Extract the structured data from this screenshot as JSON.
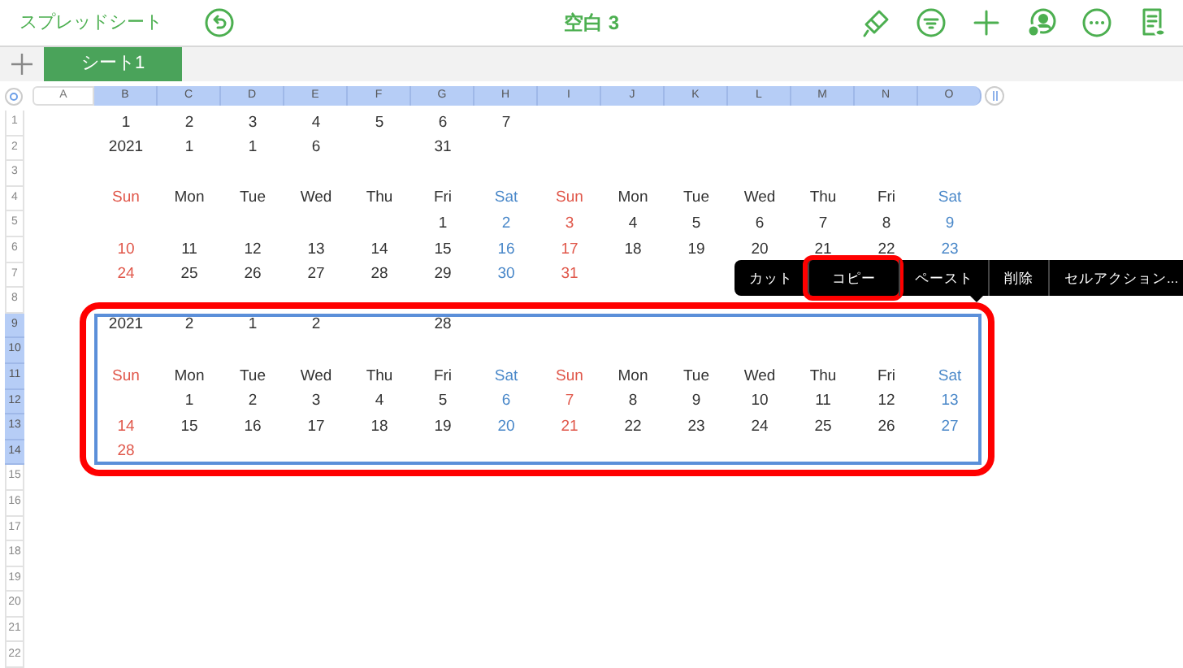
{
  "toolbar": {
    "back_label": "スプレッドシート",
    "title": "空白 3"
  },
  "sheet_tabs": [
    {
      "label": "シート1",
      "selected": true
    }
  ],
  "columns": [
    {
      "label": "A",
      "selected": false
    },
    {
      "label": "B",
      "selected": true
    },
    {
      "label": "C",
      "selected": true
    },
    {
      "label": "D",
      "selected": true
    },
    {
      "label": "E",
      "selected": true
    },
    {
      "label": "F",
      "selected": true
    },
    {
      "label": "G",
      "selected": true
    },
    {
      "label": "H",
      "selected": true
    },
    {
      "label": "I",
      "selected": true
    },
    {
      "label": "J",
      "selected": true
    },
    {
      "label": "K",
      "selected": true
    },
    {
      "label": "L",
      "selected": true
    },
    {
      "label": "M",
      "selected": true
    },
    {
      "label": "N",
      "selected": true
    },
    {
      "label": "O",
      "selected": true
    }
  ],
  "rows": [
    {
      "label": "1",
      "selected": false,
      "cells": [
        {
          "kind": "empty"
        },
        {
          "text": "1",
          "kind": "plain"
        },
        {
          "text": "2",
          "kind": "plain"
        },
        {
          "text": "3",
          "kind": "plain"
        },
        {
          "text": "4",
          "kind": "plain"
        },
        {
          "text": "5",
          "kind": "plain"
        },
        {
          "text": "6",
          "kind": "plain"
        },
        {
          "text": "7",
          "kind": "plain"
        }
      ]
    },
    {
      "label": "2",
      "selected": false,
      "cells": [
        {
          "kind": "empty"
        },
        {
          "text": "2021",
          "kind": "plain"
        },
        {
          "text": "1",
          "kind": "plain"
        },
        {
          "text": "1",
          "kind": "plain"
        },
        {
          "text": "6",
          "kind": "plain"
        },
        {
          "kind": "empty"
        },
        {
          "text": "31",
          "kind": "plain"
        }
      ]
    },
    {
      "label": "3",
      "selected": false,
      "cells": []
    },
    {
      "label": "4",
      "selected": false,
      "cells": [
        {
          "kind": "empty"
        },
        {
          "text": "Sun",
          "kind": "sunday"
        },
        {
          "text": "Mon",
          "kind": "plain"
        },
        {
          "text": "Tue",
          "kind": "plain"
        },
        {
          "text": "Wed",
          "kind": "plain"
        },
        {
          "text": "Thu",
          "kind": "plain"
        },
        {
          "text": "Fri",
          "kind": "plain"
        },
        {
          "text": "Sat",
          "kind": "saturday"
        },
        {
          "text": "Sun",
          "kind": "sunday"
        },
        {
          "text": "Mon",
          "kind": "plain"
        },
        {
          "text": "Tue",
          "kind": "plain"
        },
        {
          "text": "Wed",
          "kind": "plain"
        },
        {
          "text": "Thu",
          "kind": "plain"
        },
        {
          "text": "Fri",
          "kind": "plain"
        },
        {
          "text": "Sat",
          "kind": "saturday"
        }
      ]
    },
    {
      "label": "5",
      "selected": false,
      "cells": [
        {
          "kind": "empty"
        },
        {
          "kind": "empty"
        },
        {
          "kind": "empty"
        },
        {
          "kind": "empty"
        },
        {
          "kind": "empty"
        },
        {
          "kind": "empty"
        },
        {
          "text": "1",
          "kind": "plain"
        },
        {
          "text": "2",
          "kind": "saturday"
        },
        {
          "text": "3",
          "kind": "sunday"
        },
        {
          "text": "4",
          "kind": "plain"
        },
        {
          "text": "5",
          "kind": "plain"
        },
        {
          "text": "6",
          "kind": "plain"
        },
        {
          "text": "7",
          "kind": "plain"
        },
        {
          "text": "8",
          "kind": "plain"
        },
        {
          "text": "9",
          "kind": "saturday"
        }
      ]
    },
    {
      "label": "6",
      "selected": false,
      "cells": [
        {
          "kind": "empty"
        },
        {
          "text": "10",
          "kind": "sunday"
        },
        {
          "text": "11",
          "kind": "plain"
        },
        {
          "text": "12",
          "kind": "plain"
        },
        {
          "text": "13",
          "kind": "plain"
        },
        {
          "text": "14",
          "kind": "plain"
        },
        {
          "text": "15",
          "kind": "plain"
        },
        {
          "text": "16",
          "kind": "saturday"
        },
        {
          "text": "17",
          "kind": "sunday"
        },
        {
          "text": "18",
          "kind": "plain"
        },
        {
          "text": "19",
          "kind": "plain"
        },
        {
          "text": "20",
          "kind": "plain"
        },
        {
          "text": "21",
          "kind": "plain"
        },
        {
          "text": "22",
          "kind": "plain"
        },
        {
          "text": "23",
          "kind": "saturday"
        }
      ]
    },
    {
      "label": "7",
      "selected": false,
      "cells": [
        {
          "kind": "empty"
        },
        {
          "text": "24",
          "kind": "sunday"
        },
        {
          "text": "25",
          "kind": "plain"
        },
        {
          "text": "26",
          "kind": "plain"
        },
        {
          "text": "27",
          "kind": "plain"
        },
        {
          "text": "28",
          "kind": "plain"
        },
        {
          "text": "29",
          "kind": "plain"
        },
        {
          "text": "30",
          "kind": "saturday"
        },
        {
          "text": "31",
          "kind": "sunday"
        }
      ]
    },
    {
      "label": "8",
      "selected": false,
      "cells": []
    },
    {
      "label": "9",
      "selected": true,
      "cells": [
        {
          "kind": "empty"
        },
        {
          "text": "2021",
          "kind": "plain"
        },
        {
          "text": "2",
          "kind": "plain"
        },
        {
          "text": "1",
          "kind": "plain"
        },
        {
          "text": "2",
          "kind": "plain"
        },
        {
          "kind": "empty"
        },
        {
          "text": "28",
          "kind": "plain"
        }
      ]
    },
    {
      "label": "10",
      "selected": true,
      "cells": []
    },
    {
      "label": "11",
      "selected": true,
      "cells": [
        {
          "kind": "empty"
        },
        {
          "text": "Sun",
          "kind": "sunday"
        },
        {
          "text": "Mon",
          "kind": "plain"
        },
        {
          "text": "Tue",
          "kind": "plain"
        },
        {
          "text": "Wed",
          "kind": "plain"
        },
        {
          "text": "Thu",
          "kind": "plain"
        },
        {
          "text": "Fri",
          "kind": "plain"
        },
        {
          "text": "Sat",
          "kind": "saturday"
        },
        {
          "text": "Sun",
          "kind": "sunday"
        },
        {
          "text": "Mon",
          "kind": "plain"
        },
        {
          "text": "Tue",
          "kind": "plain"
        },
        {
          "text": "Wed",
          "kind": "plain"
        },
        {
          "text": "Thu",
          "kind": "plain"
        },
        {
          "text": "Fri",
          "kind": "plain"
        },
        {
          "text": "Sat",
          "kind": "saturday"
        }
      ]
    },
    {
      "label": "12",
      "selected": true,
      "cells": [
        {
          "kind": "empty"
        },
        {
          "kind": "empty"
        },
        {
          "text": "1",
          "kind": "plain"
        },
        {
          "text": "2",
          "kind": "plain"
        },
        {
          "text": "3",
          "kind": "plain"
        },
        {
          "text": "4",
          "kind": "plain"
        },
        {
          "text": "5",
          "kind": "plain"
        },
        {
          "text": "6",
          "kind": "saturday"
        },
        {
          "text": "7",
          "kind": "sunday"
        },
        {
          "text": "8",
          "kind": "plain"
        },
        {
          "text": "9",
          "kind": "plain"
        },
        {
          "text": "10",
          "kind": "plain"
        },
        {
          "text": "11",
          "kind": "plain"
        },
        {
          "text": "12",
          "kind": "plain"
        },
        {
          "text": "13",
          "kind": "saturday"
        }
      ]
    },
    {
      "label": "13",
      "selected": true,
      "cells": [
        {
          "kind": "empty"
        },
        {
          "text": "14",
          "kind": "sunday"
        },
        {
          "text": "15",
          "kind": "plain"
        },
        {
          "text": "16",
          "kind": "plain"
        },
        {
          "text": "17",
          "kind": "plain"
        },
        {
          "text": "18",
          "kind": "plain"
        },
        {
          "text": "19",
          "kind": "plain"
        },
        {
          "text": "20",
          "kind": "saturday"
        },
        {
          "text": "21",
          "kind": "sunday"
        },
        {
          "text": "22",
          "kind": "plain"
        },
        {
          "text": "23",
          "kind": "plain"
        },
        {
          "text": "24",
          "kind": "plain"
        },
        {
          "text": "25",
          "kind": "plain"
        },
        {
          "text": "26",
          "kind": "plain"
        },
        {
          "text": "27",
          "kind": "saturday"
        }
      ]
    },
    {
      "label": "14",
      "selected": true,
      "cells": [
        {
          "kind": "empty"
        },
        {
          "text": "28",
          "kind": "sunday"
        }
      ]
    },
    {
      "label": "15",
      "selected": false,
      "cells": []
    },
    {
      "label": "16",
      "selected": false,
      "cells": []
    },
    {
      "label": "17",
      "selected": false,
      "cells": []
    },
    {
      "label": "18",
      "selected": false,
      "cells": []
    },
    {
      "label": "19",
      "selected": false,
      "cells": []
    },
    {
      "label": "20",
      "selected": false,
      "cells": []
    },
    {
      "label": "21",
      "selected": false,
      "cells": []
    },
    {
      "label": "22",
      "selected": false,
      "cells": []
    }
  ],
  "selection": {
    "marked": true
  },
  "context_menu": [
    {
      "label": "カット",
      "highlighted": false
    },
    {
      "label": "コピー",
      "highlighted": true
    },
    {
      "label": "ペースト",
      "highlighted": false
    },
    {
      "label": "削除",
      "highlighted": false
    },
    {
      "label": "セルアクション...",
      "highlighted": false
    }
  ]
}
